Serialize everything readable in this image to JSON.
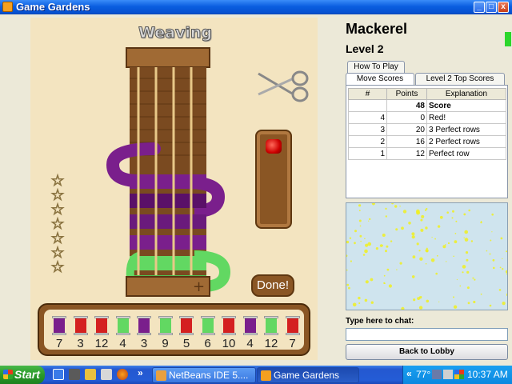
{
  "window": {
    "title": "Game Gardens",
    "minimize_label": "_",
    "maximize_label": "□",
    "close_label": "x"
  },
  "game": {
    "title": "Weaving",
    "done_label": "Done!",
    "rating_star_count": 7,
    "spools": [
      {
        "color": "#7a1f8c",
        "count": "7"
      },
      {
        "color": "#d42020",
        "count": "3"
      },
      {
        "color": "#d42020",
        "count": "12"
      },
      {
        "color": "#62d862",
        "count": "4"
      },
      {
        "color": "#7a1f8c",
        "count": "3"
      },
      {
        "color": "#62d862",
        "count": "9"
      },
      {
        "color": "#d42020",
        "count": "5"
      },
      {
        "color": "#62d862",
        "count": "6"
      },
      {
        "color": "#d42020",
        "count": "10"
      },
      {
        "color": "#7a1f8c",
        "count": "4"
      },
      {
        "color": "#62d862",
        "count": "12"
      },
      {
        "color": "#d42020",
        "count": "7"
      }
    ],
    "colors": {
      "purple": "#7a1f8c",
      "green": "#62d862",
      "red": "#d42020",
      "wood": "#8a5624",
      "board": "#f3e4c0"
    }
  },
  "sidebar": {
    "player": "Mackerel",
    "level": "Level 2",
    "tabs": {
      "how_to_play": "How To Play",
      "move_scores": "Move Scores",
      "top_scores": "Level 2 Top Scores"
    },
    "table": {
      "headers": [
        "#",
        "Points",
        "Explanation"
      ],
      "total": {
        "num": "",
        "points": "48",
        "explanation": "Score"
      },
      "rows": [
        {
          "num": "4",
          "points": "0",
          "explanation": "Red!"
        },
        {
          "num": "3",
          "points": "20",
          "explanation": "3 Perfect rows"
        },
        {
          "num": "2",
          "points": "16",
          "explanation": "2 Perfect rows"
        },
        {
          "num": "1",
          "points": "12",
          "explanation": "Perfect row"
        }
      ]
    },
    "chat_label": "Type here to chat:",
    "chat_input_value": "",
    "back_button": "Back to Lobby"
  },
  "taskbar": {
    "start_label": "Start",
    "more_label": "»",
    "tasks": [
      {
        "label": "NetBeans IDE 5....",
        "active": false
      },
      {
        "label": "Game Gardens",
        "active": true
      }
    ],
    "tray_arrow": "«",
    "temperature": "77°",
    "clock": "10:37 AM"
  }
}
